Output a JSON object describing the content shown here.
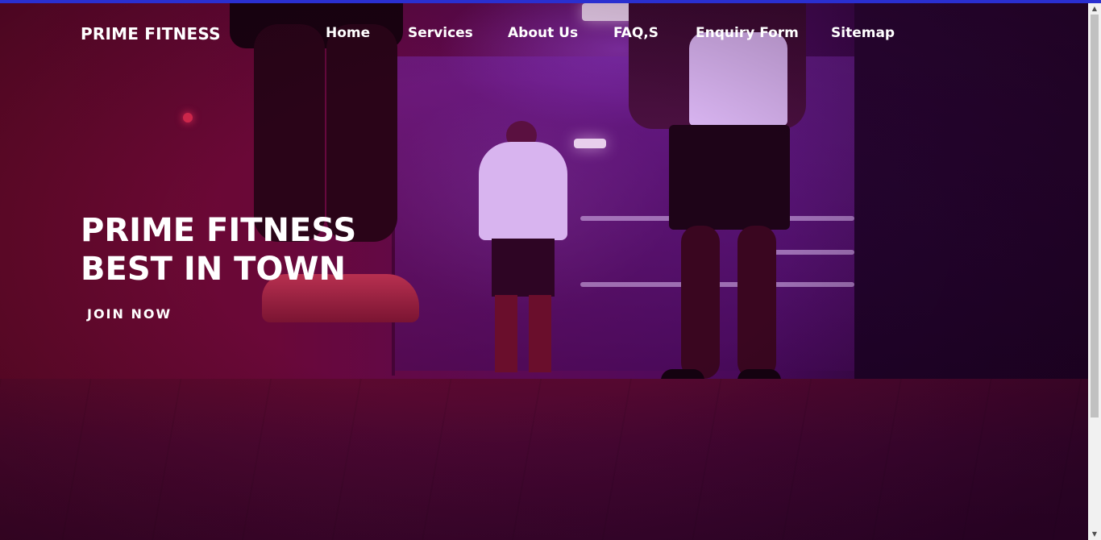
{
  "brand": {
    "name": "PRIME FITNESS"
  },
  "nav": {
    "items": [
      {
        "label": "Home"
      },
      {
        "label": "Services"
      },
      {
        "label": "About Us"
      },
      {
        "label": "FAQ,S"
      },
      {
        "label": "Enquiry Form"
      },
      {
        "label": "Sitemap"
      }
    ]
  },
  "hero": {
    "title_line1": "PRIME FITNESS",
    "title_line2": "BEST IN TOWN",
    "cta_label": "JOIN NOW"
  },
  "scrollbar": {
    "up_icon": "▲",
    "down_icon": "▼"
  },
  "colors": {
    "accent_bar": "#2a2fd0",
    "overlay_left": "#6d0a2c",
    "overlay_right": "#1a0226",
    "text": "#ffffff"
  }
}
